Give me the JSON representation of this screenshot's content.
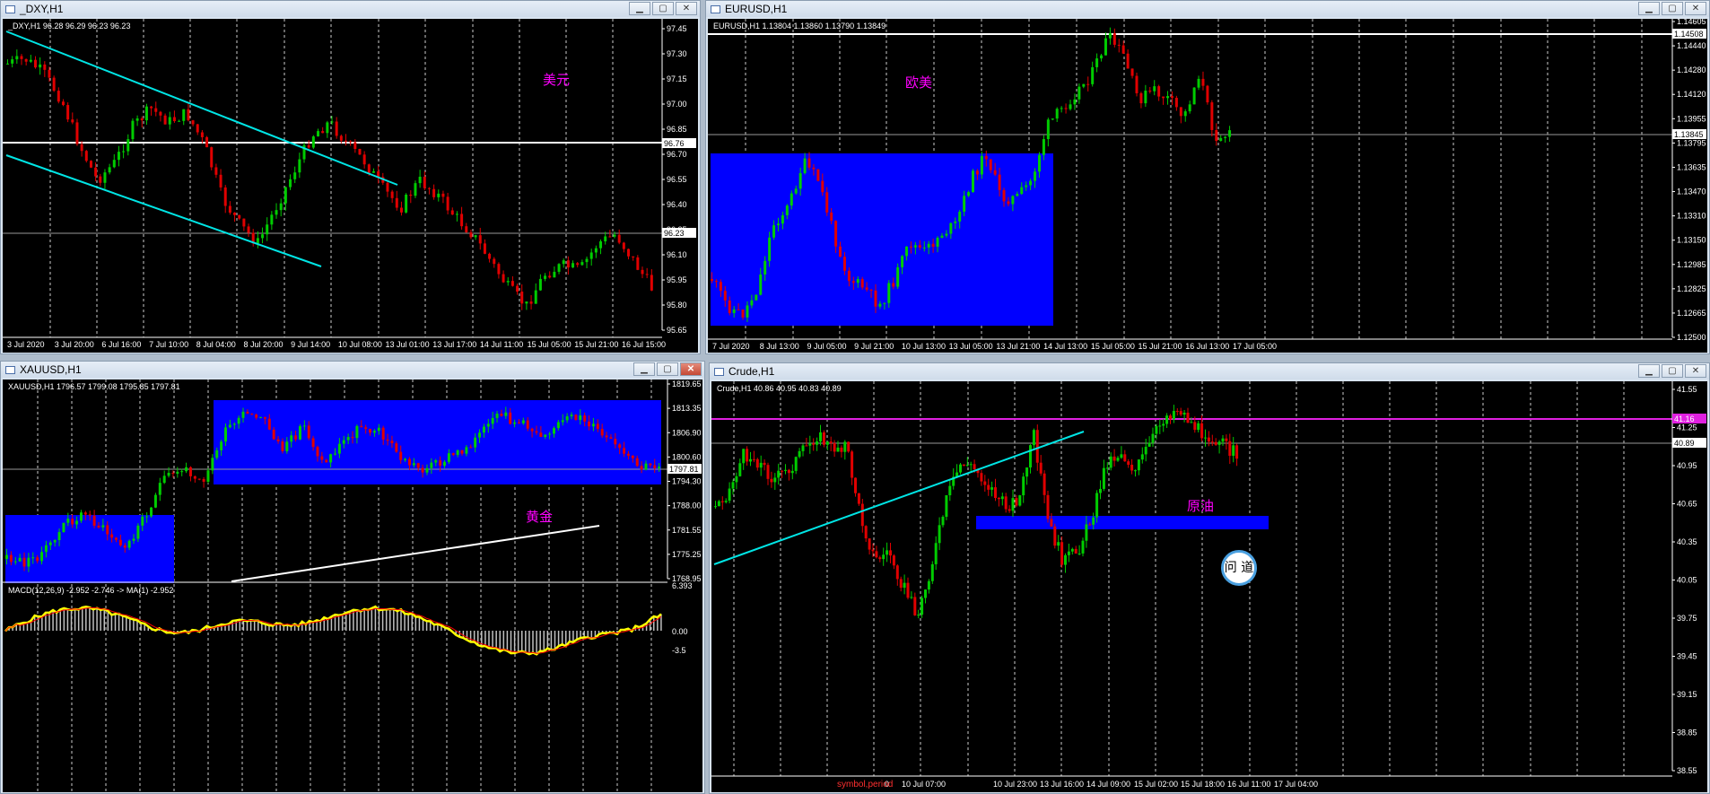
{
  "colors": {
    "bull": "#00cc00",
    "bear": "#e00000",
    "trend": "#00e5e5",
    "zone": "#0000ff",
    "magenta": "#ff00ff",
    "bg": "#000000",
    "grid": "#ffffff"
  },
  "windows": [
    {
      "id": "dxy",
      "title": "_DXY,H1",
      "ohlc": "_DXY,H1  96.28 96.29 96.23 96.23",
      "label": "美元",
      "label_color": "#ff00ff",
      "price_ticks": [
        "97.45",
        "97.30",
        "97.15",
        "97.00",
        "96.85",
        "96.70",
        "96.55",
        "96.40",
        "96.25",
        "96.10",
        "95.95",
        "95.80",
        "95.65"
      ],
      "time_ticks": [
        "3 Jul 2020",
        "3 Jul 20:00",
        "6 Jul 16:00",
        "7 Jul 10:00",
        "8 Jul 04:00",
        "8 Jul 20:00",
        "9 Jul 14:00",
        "10 Jul 08:00",
        "13 Jul 01:00",
        "13 Jul 17:00",
        "14 Jul 11:00",
        "15 Jul 05:00",
        "15 Jul 21:00",
        "16 Jul 15:00"
      ],
      "hline_label": "96.76",
      "cur_price": "96.23",
      "buttons": [
        "minimize-icon",
        "maximize-icon",
        "close-icon"
      ],
      "close_active": false
    },
    {
      "id": "eurusd",
      "title": "EURUSD,H1",
      "ohlc": "EURUSD,H1  1.13804 1.13860 1.13790 1.13849",
      "label": "欧美",
      "label_color": "#ff00ff",
      "price_ticks": [
        "1.14605",
        "1.14440",
        "1.14280",
        "1.14120",
        "1.13955",
        "1.13795",
        "1.13635",
        "1.13470",
        "1.13310",
        "1.13150",
        "1.12985",
        "1.12825",
        "1.12665",
        "1.12500"
      ],
      "time_ticks": [
        "7 Jul 2020",
        "8 Jul 13:00",
        "9 Jul 05:00",
        "9 Jul 21:00",
        "10 Jul 13:00",
        "13 Jul 05:00",
        "13 Jul 21:00",
        "14 Jul 13:00",
        "15 Jul 05:00",
        "15 Jul 21:00",
        "16 Jul 13:00",
        "17 Jul 05:00"
      ],
      "hline_label": "1.14508",
      "cur_price": "1.13845",
      "buttons": [
        "minimize-icon",
        "maximize-icon",
        "close-icon"
      ],
      "close_active": false
    },
    {
      "id": "xauusd",
      "title": "XAUUSD,H1",
      "ohlc": "XAUUSD,H1  1796.57 1799.08 1795.85 1797.81",
      "label": "黄金",
      "label_color": "#ff00ff",
      "price_ticks": [
        "1819.65",
        "1813.35",
        "1806.90",
        "1800.60",
        "1794.30",
        "1788.00",
        "1781.55",
        "1775.25",
        "1768.95"
      ],
      "time_ticks": [],
      "cur_price": "1797.81",
      "macd_label": "MACD(12,26,9) -2.952 -2.746 -> MA(1) -2.952",
      "macd_ticks": [
        "6.393",
        "0.00",
        "-3.5"
      ],
      "buttons": [
        "minimize-icon",
        "maximize-icon",
        "close-icon"
      ],
      "close_active": true
    },
    {
      "id": "crude",
      "title": "Crude,H1",
      "ohlc": "Crude,H1  40.86 40.95 40.83 40.89",
      "label": "原油",
      "label_color": "#ff00ff",
      "price_ticks": [
        "41.55",
        "41.25",
        "40.95",
        "40.65",
        "40.35",
        "40.05",
        "39.75",
        "39.45",
        "39.15",
        "38.85",
        "38.55"
      ],
      "time_ticks": [
        "0",
        "10 Jul 07:00",
        "10 Jul 23:00",
        "13 Jul 16:00",
        "14 Jul 09:00",
        "15 Jul 02:00",
        "15 Jul 18:00",
        "16 Jul 11:00",
        "17 Jul 04:00"
      ],
      "hline_label": "41.16",
      "cur_price": "40.89",
      "footer_text": "symbol,period",
      "stamp_text": "问 道",
      "buttons": [
        "minimize-icon",
        "maximize-icon",
        "close-icon"
      ],
      "close_active": false
    }
  ]
}
